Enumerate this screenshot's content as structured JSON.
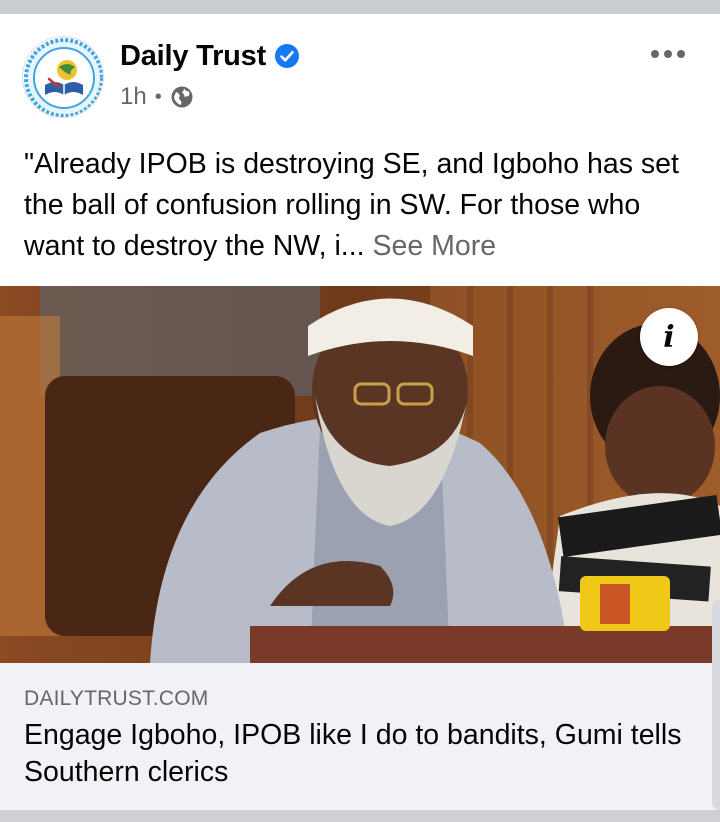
{
  "post": {
    "page_name": "Daily Trust",
    "time": "1h",
    "separator": "•",
    "privacy_icon": "globe-icon",
    "verified_icon": "verified-badge-icon",
    "more_icon": "more-options-icon",
    "text": "\"Already IPOB is destroying SE, and Igboho has set the ball of confusion rolling in SW. For those who want to destroy the NW, i...",
    "see_more": "See More"
  },
  "media": {
    "info_label": "i"
  },
  "link_preview": {
    "domain": "DAILYTRUST.COM",
    "title": "Engage Igboho, IPOB like I do to bandits, Gumi tells Southern clerics"
  },
  "colors": {
    "accent": "#1877f2",
    "secondary_text": "#65676b",
    "preview_bg": "#f0f2f5"
  }
}
